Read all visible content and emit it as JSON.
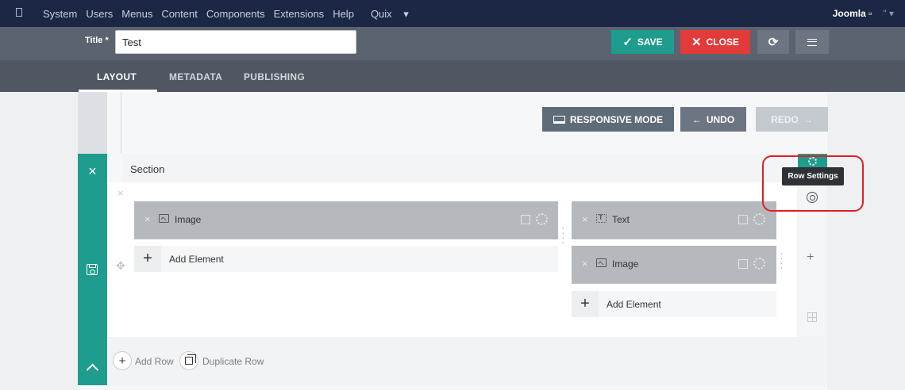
{
  "topbar": {
    "menu": [
      "System",
      "Users",
      "Menus",
      "Content",
      "Components",
      "Extensions",
      "Help"
    ],
    "quix_label": "Quix",
    "site_label": "Joomla",
    "extra": "\""
  },
  "header": {
    "title_label": "Title *",
    "title_value": "Test",
    "save_label": "SAVE",
    "close_label": "CLOSE"
  },
  "tabs": [
    "LAYOUT",
    "METADATA",
    "PUBLISHING"
  ],
  "toolbar": {
    "responsive_label": "RESPONSIVE MODE",
    "undo_label": "UNDO",
    "redo_label": "REDO"
  },
  "section": {
    "title": "Section",
    "tooltip": "Row Settings",
    "columns": [
      {
        "elements": [
          {
            "icon": "image-icon",
            "label": "Image"
          }
        ],
        "add_label": "Add Element"
      },
      {
        "elements": [
          {
            "icon": "text-icon",
            "label": "Text"
          },
          {
            "icon": "image-icon",
            "label": "Image"
          }
        ],
        "add_label": "Add Element"
      }
    ],
    "add_row_label": "Add Row",
    "duplicate_row_label": "Duplicate Row"
  },
  "colors": {
    "teal": "#1e9c8e",
    "red": "#e33a3a",
    "navy": "#1c2745",
    "highlight": "#e41d25"
  }
}
